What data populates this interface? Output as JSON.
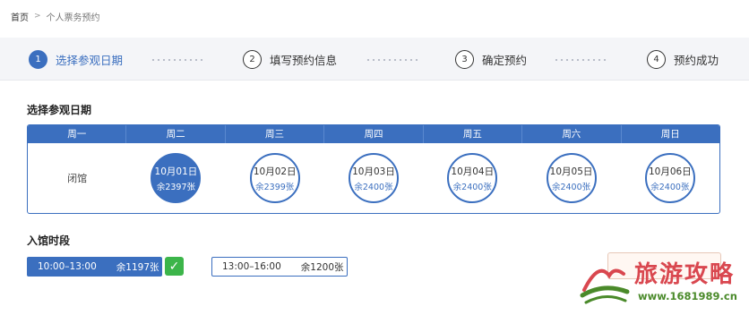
{
  "breadcrumb": {
    "home": "首页",
    "separator": ">",
    "current": "个人票务预约"
  },
  "steps": [
    {
      "num": "1",
      "label": "选择参观日期",
      "active": true
    },
    {
      "num": "2",
      "label": "填写预约信息",
      "active": false
    },
    {
      "num": "3",
      "label": "确定预约",
      "active": false
    },
    {
      "num": "4",
      "label": "预约成功",
      "active": false
    }
  ],
  "date_section": {
    "title": "选择参观日期"
  },
  "calendar": {
    "weekdays": [
      "周一",
      "周二",
      "周三",
      "周四",
      "周五",
      "周六",
      "周日"
    ],
    "days": [
      {
        "closed": true,
        "text": "闭馆"
      },
      {
        "date": "10月01日",
        "remaining": "余2397张",
        "selected": true
      },
      {
        "date": "10月02日",
        "remaining": "余2399张",
        "selected": false
      },
      {
        "date": "10月03日",
        "remaining": "余2400张",
        "selected": false
      },
      {
        "date": "10月04日",
        "remaining": "余2400张",
        "selected": false
      },
      {
        "date": "10月05日",
        "remaining": "余2400张",
        "selected": false
      },
      {
        "date": "10月06日",
        "remaining": "余2400张",
        "selected": false
      }
    ]
  },
  "time_section": {
    "title": "入馆时段"
  },
  "time_slots": [
    {
      "time": "10:00–13:00",
      "remaining": "余1197张",
      "selected": true
    },
    {
      "time": "13:00–16:00",
      "remaining": "余1200张",
      "selected": false
    }
  ],
  "check_icon": "✓",
  "watermark": {
    "title": "旅游攻略",
    "url": "www.1681989.cn"
  },
  "colors": {
    "accent": "#3b6fbf",
    "success": "#3cb54a",
    "watermark_red": "#d9474f",
    "watermark_green": "#4a8a2a"
  }
}
